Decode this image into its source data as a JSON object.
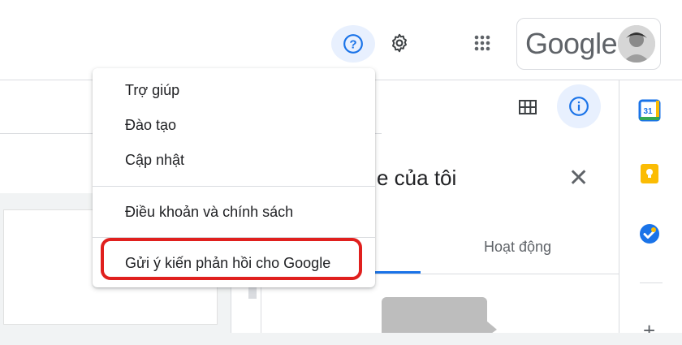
{
  "header": {
    "account_label": "Google",
    "icons": [
      "help-icon",
      "gear-icon",
      "apps-grid-icon",
      "avatar"
    ]
  },
  "toolbar": {
    "icons": [
      "grid-view-icon",
      "info-icon"
    ]
  },
  "details_panel": {
    "title": "e của tôi",
    "tabs": [
      {
        "label": ""
      },
      {
        "label": "Hoạt động"
      }
    ]
  },
  "help_menu": {
    "items": [
      {
        "label": "Trợ giúp"
      },
      {
        "label": "Đào tạo"
      },
      {
        "label": "Cập nhật"
      },
      {
        "label": "Điều khoản và chính sách"
      },
      {
        "label": "Gửi ý kiến phản hồi cho Google"
      }
    ]
  },
  "side_panel": {
    "icons": [
      "calendar-icon",
      "keep-icon",
      "tasks-icon",
      "plus-icon"
    ],
    "calendar_day": "31"
  },
  "colors": {
    "accent": "#1a73e8",
    "highlight_border": "#e0201e",
    "calendar": "#1a73e8",
    "keep": "#fbbc04",
    "tasks": "#1a73e8"
  }
}
